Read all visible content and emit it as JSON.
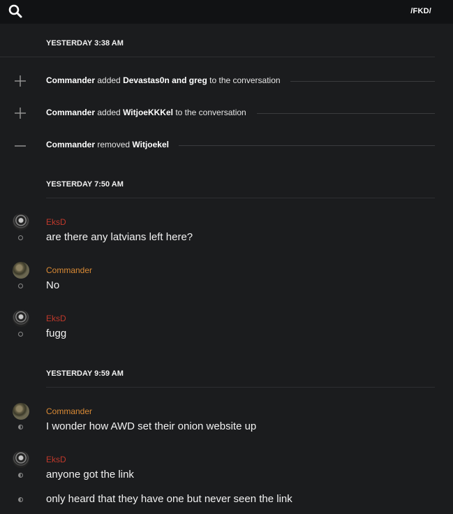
{
  "header": {
    "channel": "/FKD/"
  },
  "separators": [
    "YESTERDAY 3:38 AM",
    "YESTERDAY 7:50 AM",
    "YESTERDAY 9:59 AM"
  ],
  "system_events": [
    {
      "icon": "plus-icon",
      "actor": "Commander",
      "verb": "added",
      "targets": "Devastas0n and greg",
      "suffix": "to the conversation"
    },
    {
      "icon": "plus-icon",
      "actor": "Commander",
      "verb": "added",
      "targets": "WitjoeKKKel",
      "suffix": "to the conversation"
    },
    {
      "icon": "minus-icon",
      "actor": "Commander",
      "verb": "removed",
      "targets": "Witjoekel",
      "suffix": ""
    }
  ],
  "messages": [
    {
      "author": "EksD",
      "text": "are there any latvians left here?"
    },
    {
      "author": "Commander",
      "text": "No"
    },
    {
      "author": "EksD",
      "text": "fugg"
    },
    {
      "author": "Commander",
      "text": "I wonder how AWD set their onion website up"
    },
    {
      "author": "EksD",
      "text": "anyone got the link"
    },
    {
      "author": "",
      "text": "only heard that they have one but never seen the link"
    }
  ],
  "colors": {
    "eksd": "#c0392b",
    "commander": "#d98a35",
    "background": "#1b1c1e"
  }
}
